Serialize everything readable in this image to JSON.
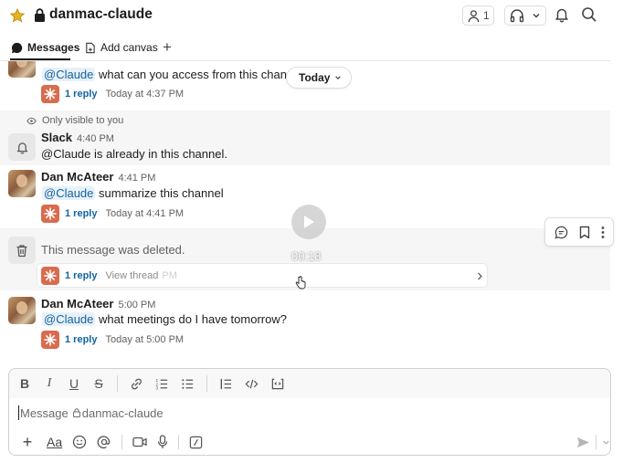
{
  "channel": {
    "name": "danmac-claude",
    "member_count": "1"
  },
  "tabs": {
    "messages": "Messages",
    "add_canvas": "Add canvas"
  },
  "messages": [
    {
      "text": "what can you access from this channel?",
      "mention": "@Claude",
      "replies": {
        "count": "1 reply",
        "time": "Today at 4:37 PM"
      }
    },
    {
      "notice": "Only visible to you",
      "author": "Slack",
      "time": "4:40 PM",
      "text": "@Claude is already in this channel."
    },
    {
      "author": "Dan McAteer",
      "time": "4:41 PM",
      "mention": "@Claude",
      "text": "summarize this channel",
      "replies": {
        "count": "1 reply",
        "time": "Today at 4:41 PM"
      }
    },
    {
      "text": "This message was deleted.",
      "replies": {
        "count": "1 reply",
        "hover": "View thread",
        "time_fragment": "PM"
      }
    },
    {
      "author": "Dan McAteer",
      "time": "5:00 PM",
      "mention": "@Claude",
      "text": "what meetings do I have tomorrow?",
      "replies": {
        "count": "1 reply",
        "time": "Today at 5:00 PM"
      }
    }
  ],
  "date_divider": "Today",
  "video": {
    "time": "00:18"
  },
  "composer": {
    "placeholder": "Message",
    "channel": "danmac-claude",
    "format_aa": "Aa"
  },
  "colors": {
    "mention": "#1264a3",
    "claude_badge": "#d96b4e",
    "star": "#e8b21c"
  }
}
